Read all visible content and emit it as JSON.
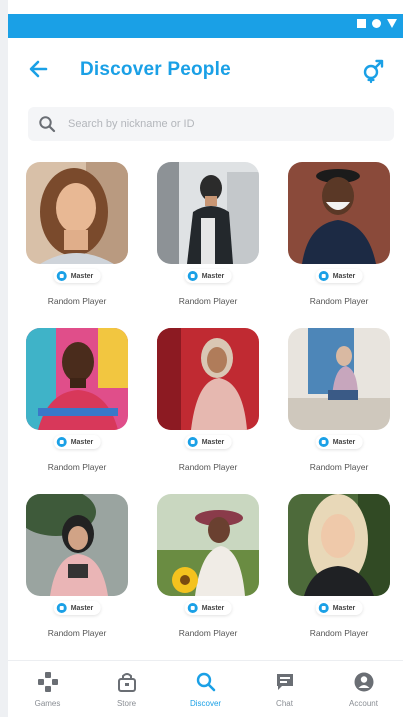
{
  "header": {
    "title": "Discover People"
  },
  "search": {
    "placeholder": "Search by nickname or ID"
  },
  "players": [
    {
      "name": "Random Player",
      "badge": "Master"
    },
    {
      "name": "Random Player",
      "badge": "Master"
    },
    {
      "name": "Random Player",
      "badge": "Master"
    },
    {
      "name": "Random Player",
      "badge": "Master"
    },
    {
      "name": "Random Player",
      "badge": "Master"
    },
    {
      "name": "Random Player",
      "badge": "Master"
    },
    {
      "name": "Random Player",
      "badge": "Master"
    },
    {
      "name": "Random Player",
      "badge": "Master"
    },
    {
      "name": "Random Player",
      "badge": "Master"
    }
  ],
  "nav": {
    "items": [
      {
        "label": "Games",
        "icon": "gamepad-icon"
      },
      {
        "label": "Store",
        "icon": "bag-icon"
      },
      {
        "label": "Discover",
        "icon": "search-icon"
      },
      {
        "label": "Chat",
        "icon": "chat-icon"
      },
      {
        "label": "Account",
        "icon": "account-icon"
      }
    ],
    "active": "Discover"
  },
  "colors": {
    "accent": "#1aa0e6",
    "statusbar": "#1aa0e6"
  }
}
